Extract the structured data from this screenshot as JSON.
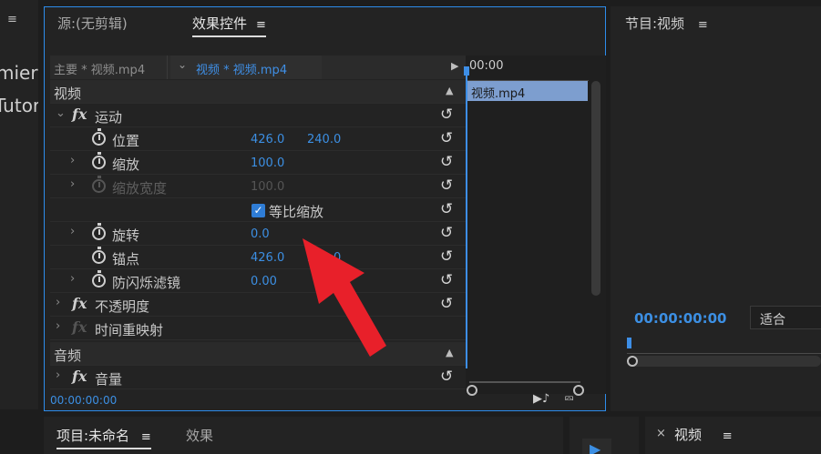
{
  "left_panel": {
    "menu": "≡",
    "text1": "mier",
    "text2": "Tutor"
  },
  "effect_controls": {
    "tab_source": "源:(无剪辑)",
    "tab_effect": "效果控件",
    "tab_menu": "≡",
    "master_clip": "主要 * 视频.mp4",
    "current_clip": "视频 * 视频.mp4",
    "section_video": "视频",
    "section_audio": "音频",
    "motion": {
      "label": "运动"
    },
    "position": {
      "label": "位置",
      "x": "426.0",
      "y": "240.0"
    },
    "scale": {
      "label": "缩放",
      "value": "100.0"
    },
    "scale_width": {
      "label": "缩放宽度",
      "value": "100.0"
    },
    "uniform_scale": {
      "label": "等比缩放",
      "checked": true
    },
    "rotation": {
      "label": "旋转",
      "value": "0.0"
    },
    "anchor": {
      "label": "锚点",
      "x": "426.0",
      "y": "240.0"
    },
    "anti_flicker": {
      "label": "防闪烁滤镜",
      "value": "0.00"
    },
    "opacity": {
      "label": "不透明度"
    },
    "time_remap": {
      "label": "时间重映射"
    },
    "volume": {
      "label": "音量"
    },
    "footer_time": "00:00:00:00"
  },
  "mini_timeline": {
    "time": "00:00",
    "clip": "视频.mp4"
  },
  "program_monitor": {
    "title": "节目:视频",
    "menu": "≡",
    "timecode": "00:00:00:00",
    "fit": "适合"
  },
  "project_panel": {
    "tab_project": "项目:未命名",
    "menu": "≡",
    "tab_effects": "效果"
  },
  "timeline_panel": {
    "close": "×",
    "title": "视频",
    "menu": "≡"
  },
  "colors": {
    "accent": "#2d8ceb",
    "value_blue": "#3c8fe3",
    "arrow_red": "#e8202a"
  }
}
